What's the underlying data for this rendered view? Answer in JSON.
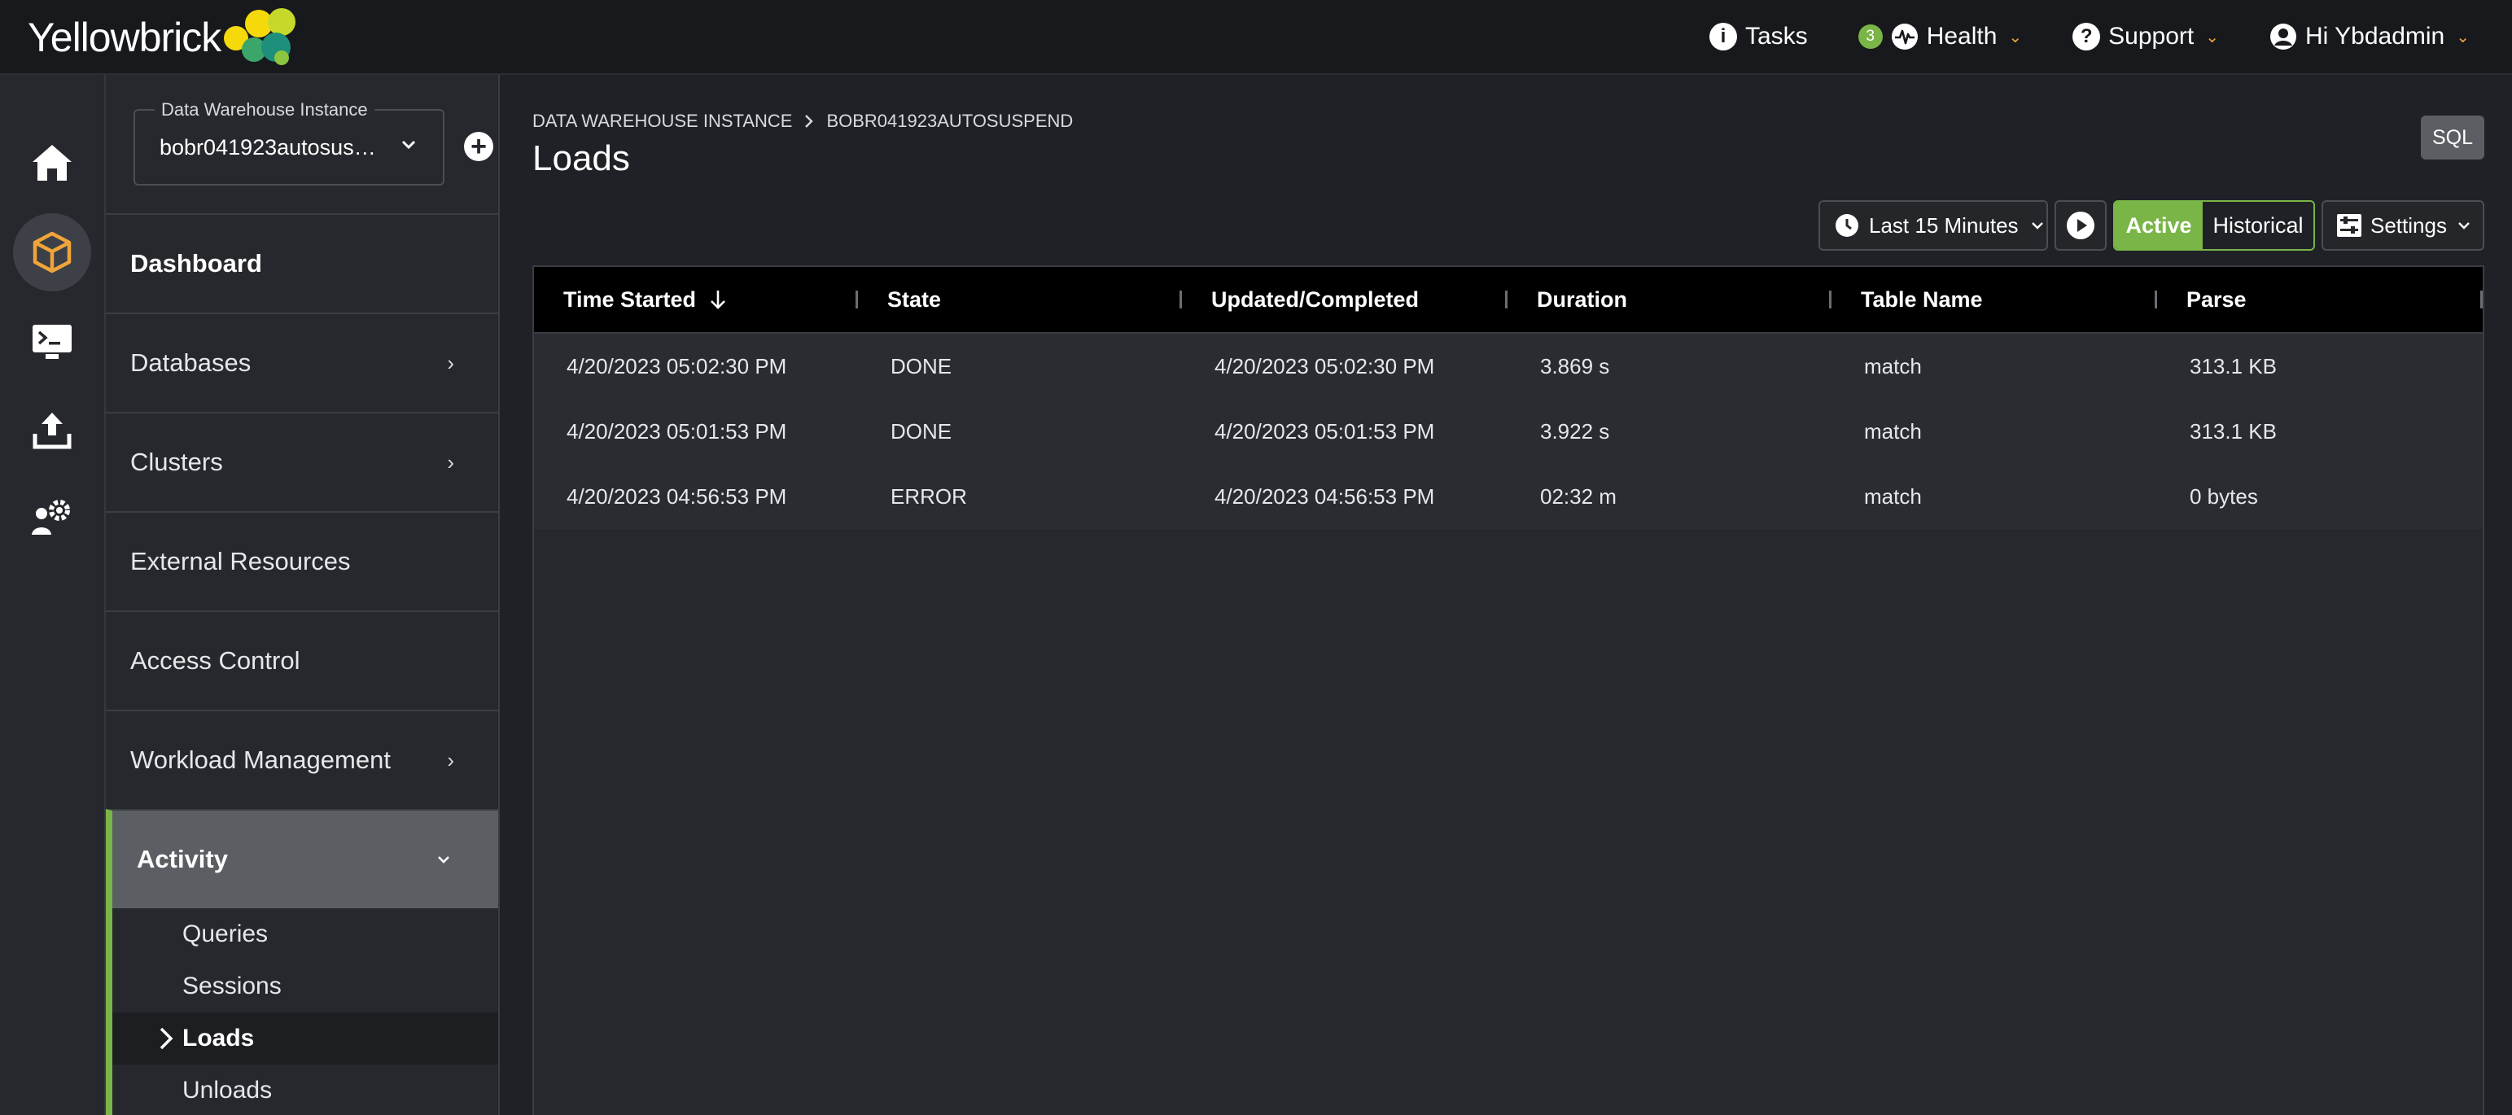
{
  "app": {
    "brand": "Yellowbrick",
    "colors": {
      "accent": "#7ab547",
      "highlight": "#f0a43a",
      "background": "#1f2126"
    }
  },
  "topnav": {
    "tasks": "Tasks",
    "health_count": "3",
    "health": "Health",
    "support": "Support",
    "user": "Hi Ybdadmin"
  },
  "rail": {
    "items": [
      "home-icon",
      "cube-icon",
      "terminal-icon",
      "upload-icon",
      "admin-gear-icon"
    ]
  },
  "sidebar": {
    "instance_label": "Data Warehouse Instance",
    "instance_value": "bobr041923autosus…",
    "nav": {
      "dashboard": "Dashboard",
      "databases": "Databases",
      "clusters": "Clusters",
      "external_resources": "External Resources",
      "access_control": "Access Control",
      "workload_management": "Workload Management",
      "activity": "Activity"
    },
    "activity_sub": {
      "queries": "Queries",
      "sessions": "Sessions",
      "loads": "Loads",
      "unloads": "Unloads"
    }
  },
  "main": {
    "breadcrumb": [
      "DATA WAREHOUSE INSTANCE",
      "BOBR041923AUTOSUSPEND"
    ],
    "title": "Loads",
    "sql_button": "SQL",
    "time_range": "Last 15 Minutes",
    "toggle_active": "Active",
    "toggle_historical": "Historical",
    "settings": "Settings"
  },
  "table": {
    "columns": [
      "Time Started",
      "State",
      "Updated/Completed",
      "Duration",
      "Table Name",
      "Parse"
    ],
    "rows": [
      [
        "4/20/2023 05:02:30 PM",
        "DONE",
        "4/20/2023 05:02:30 PM",
        "3.869 s",
        "match",
        "313.1 KB"
      ],
      [
        "4/20/2023 05:01:53 PM",
        "DONE",
        "4/20/2023 05:01:53 PM",
        "3.922 s",
        "match",
        "313.1 KB"
      ],
      [
        "4/20/2023 04:56:53 PM",
        "ERROR",
        "4/20/2023 04:56:53 PM",
        "02:32 m",
        "match",
        "0 bytes"
      ]
    ]
  }
}
